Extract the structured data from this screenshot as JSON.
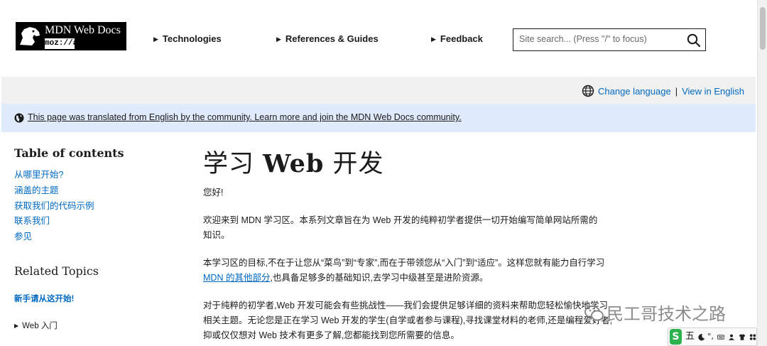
{
  "header": {
    "logo_title": "MDN Web Docs",
    "logo_sub": "moz://a",
    "nav": [
      "Technologies",
      "References & Guides",
      "Feedback"
    ],
    "search_placeholder": "Site search... (Press \"/\" to focus)"
  },
  "lang_bar": {
    "change_language": "Change language",
    "separator": "|",
    "view_english": "View in English"
  },
  "notice": {
    "text": "This page was translated from English by the community. Learn more and join the MDN Web Docs community."
  },
  "sidebar": {
    "toc_title": "Table of contents",
    "toc_items": [
      "从哪里开始?",
      "涵盖的主题",
      "获取我们的代码示例",
      "联系我们",
      "参见"
    ],
    "related_title": "Related Topics",
    "related_link": "新手请从这开始!",
    "related_details": "Web 入门"
  },
  "article": {
    "title_pre": "学习 ",
    "title_bold": "Web",
    "title_post": " 开发",
    "p1": "您好!",
    "p2": "欢迎来到 MDN 学习区。本系列文章旨在为 Web 开发的纯粹初学者提供一切开始编写简单网站所需的知识。",
    "p3_pre": "本学习区的目标,不在于让您从“菜鸟”到“专家”,而在于带领您从“入门”到“适应”。这样您就有能力自行学习 ",
    "p3_link": "MDN 的其他部分",
    "p3_post": ",也具备足够多的基础知识,去学习中级甚至是进阶资源。",
    "p4": "对于纯粹的初学者,Web 开发可能会有些挑战性——我们会提供足够详细的资料来帮助您轻松愉快地学习相关主题。无论您是正在学习 Web 开发的学生(自学或者参与课程),寻找课堂材料的老师,还是编程爱好者,抑或仅仅想对 Web 技术有更多了解,您都能找到您所需要的信息。"
  },
  "watermark": {
    "text": "民工哥技术之路"
  },
  "ime": {
    "logo": "S",
    "mode": "五",
    "punct": "°,"
  },
  "colors": {
    "link": "#0069c2",
    "notice_bg": "#dfeafb",
    "lang_bg": "#f2f1f1",
    "ime_green": "#2bb24c"
  }
}
